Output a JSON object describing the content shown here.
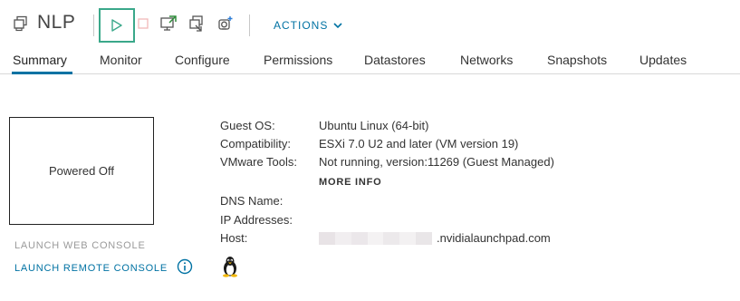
{
  "header": {
    "title": "NLP",
    "vm_icon": "vm-icon",
    "toolbar": {
      "power_on_icon": "play-icon",
      "power_off_icon": "stop-icon",
      "console_icon": "launch-console-icon",
      "migrate_icon": "migrate-icon",
      "snapshot_icon": "snapshot-icon",
      "actions_label": "ACTIONS"
    },
    "accent_color": "#0072a3",
    "highlight_color": "#3aa88a"
  },
  "tabs": [
    "Summary",
    "Monitor",
    "Configure",
    "Permissions",
    "Datastores",
    "Networks",
    "Snapshots",
    "Updates"
  ],
  "console": {
    "status": "Powered Off",
    "launch_web_console": "LAUNCH WEB CONSOLE",
    "launch_remote_console": "LAUNCH REMOTE CONSOLE"
  },
  "properties": {
    "guest_os": {
      "label": "Guest OS:",
      "value": "Ubuntu Linux (64-bit)"
    },
    "compatibility": {
      "label": "Compatibility:",
      "value": "ESXi 7.0 U2 and later (VM version 19)"
    },
    "vmware_tools": {
      "label": "VMware Tools:",
      "value": "Not running, version:11269 (Guest Managed)"
    },
    "more_info": "MORE INFO",
    "dns_name": {
      "label": "DNS Name:",
      "value": ""
    },
    "ip_addresses": {
      "label": "IP Addresses:",
      "value": ""
    },
    "host": {
      "label": "Host:",
      "value_suffix": ".nvidialaunchpad.com"
    }
  }
}
